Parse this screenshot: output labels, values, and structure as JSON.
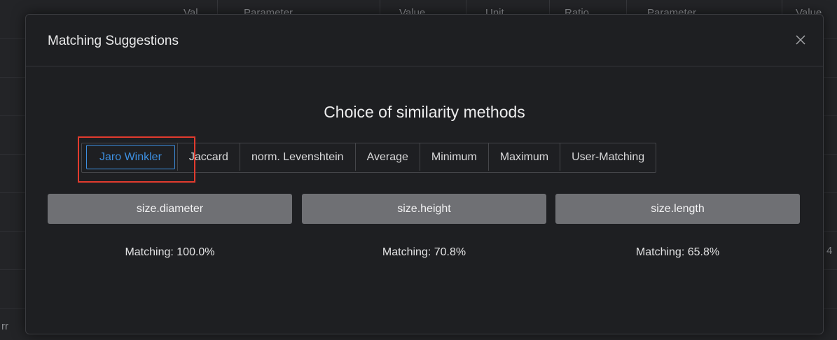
{
  "background": {
    "header_fragments": [
      "Val",
      "Parameter",
      "Value",
      "Unit",
      "Ratio",
      "Parameter",
      "Value"
    ],
    "right_fragment": "4",
    "left_fragment": "rr"
  },
  "modal": {
    "title": "Matching Suggestions",
    "close_icon": "close-icon",
    "section_title": "Choice of similarity methods",
    "methods": [
      {
        "label": "Jaro Winkler",
        "active": true
      },
      {
        "label": "Jaccard",
        "active": false
      },
      {
        "label": "norm. Levenshtein",
        "active": false
      },
      {
        "label": "Average",
        "active": false
      },
      {
        "label": "Minimum",
        "active": false
      },
      {
        "label": "Maximum",
        "active": false
      },
      {
        "label": "User-Matching",
        "active": false
      }
    ],
    "suggestions": [
      {
        "attribute": "size.diameter",
        "matching": "Matching: 100.0%"
      },
      {
        "attribute": "size.height",
        "matching": "Matching: 70.8%"
      },
      {
        "attribute": "size.length",
        "matching": "Matching: 65.8%"
      }
    ]
  },
  "colors": {
    "accent": "#3d8fe0",
    "highlight": "#e23b2e",
    "button_bg": "#6f7074"
  }
}
